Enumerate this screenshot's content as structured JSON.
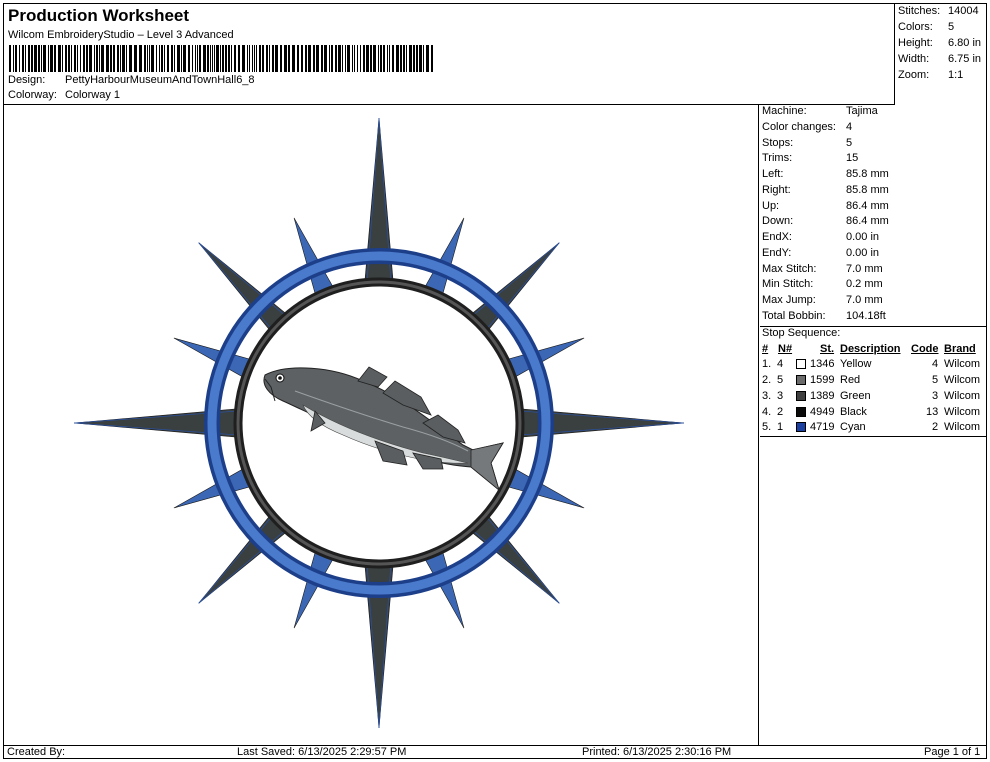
{
  "header": {
    "title": "Production Worksheet",
    "subtitle": "Wilcom EmbroideryStudio – Level 3 Advanced",
    "design_label": "Design:",
    "design_value": "PettyHarbourMuseumAndTownHall6_8",
    "colorway_label": "Colorway:",
    "colorway_value": "Colorway 1"
  },
  "summary": [
    {
      "label": "Stitches:",
      "value": "14004"
    },
    {
      "label": "Colors:",
      "value": "5"
    },
    {
      "label": "Height:",
      "value": "6.80 in"
    },
    {
      "label": "Width:",
      "value": "6.75 in"
    },
    {
      "label": "Zoom:",
      "value": "1:1"
    }
  ],
  "details": [
    {
      "label": "Machine:",
      "value": "Tajima"
    },
    {
      "label": "Color changes:",
      "value": "4"
    },
    {
      "label": "Stops:",
      "value": "5"
    },
    {
      "label": "Trims:",
      "value": "15"
    },
    {
      "label": "Left:",
      "value": "85.8 mm"
    },
    {
      "label": "Right:",
      "value": "85.8 mm"
    },
    {
      "label": "Up:",
      "value": "86.4 mm"
    },
    {
      "label": "Down:",
      "value": "86.4 mm"
    },
    {
      "label": "EndX:",
      "value": "0.00 in"
    },
    {
      "label": "EndY:",
      "value": "0.00 in"
    },
    {
      "label": "Max Stitch:",
      "value": "7.0 mm"
    },
    {
      "label": "Min Stitch:",
      "value": "0.2 mm"
    },
    {
      "label": "Max Jump:",
      "value": "7.0 mm"
    },
    {
      "label": "Total Bobbin:",
      "value": "104.18ft"
    }
  ],
  "stops": {
    "title": "Stop Sequence:",
    "headers": {
      "num": "#",
      "n": "N#",
      "st": "St.",
      "description": "Description",
      "code": "Code",
      "brand": "Brand"
    },
    "rows": [
      {
        "num": "1.",
        "n": "4",
        "color": "#ffffff",
        "st": "1346",
        "description": "Yellow",
        "code": "4",
        "brand": "Wilcom"
      },
      {
        "num": "2.",
        "n": "5",
        "color": "#6b6b6b",
        "st": "1599",
        "description": "Red",
        "code": "5",
        "brand": "Wilcom"
      },
      {
        "num": "3.",
        "n": "3",
        "color": "#3f3f3f",
        "st": "1389",
        "description": "Green",
        "code": "3",
        "brand": "Wilcom"
      },
      {
        "num": "4.",
        "n": "2",
        "color": "#0a0a0a",
        "st": "4949",
        "description": "Black",
        "code": "13",
        "brand": "Wilcom"
      },
      {
        "num": "5.",
        "n": "1",
        "color": "#1a3fa0",
        "st": "4719",
        "description": "Cyan",
        "code": "2",
        "brand": "Wilcom"
      }
    ]
  },
  "footer": {
    "created_by": "Created By:",
    "last_saved": "Last Saved: 6/13/2025 2:29:57 PM",
    "printed": "Printed: 6/13/2025 2:30:16 PM",
    "page": "Page 1 of 1"
  },
  "colors": {
    "ring_blue": "#3b67b5",
    "ring_black": "#2a2a2a",
    "point_dark": "#3a3f3f",
    "point_blue": "#3b67b5"
  },
  "icons": {
    "barcode": "barcode-graphic",
    "design": "compass-rose-fish-embroidery"
  }
}
